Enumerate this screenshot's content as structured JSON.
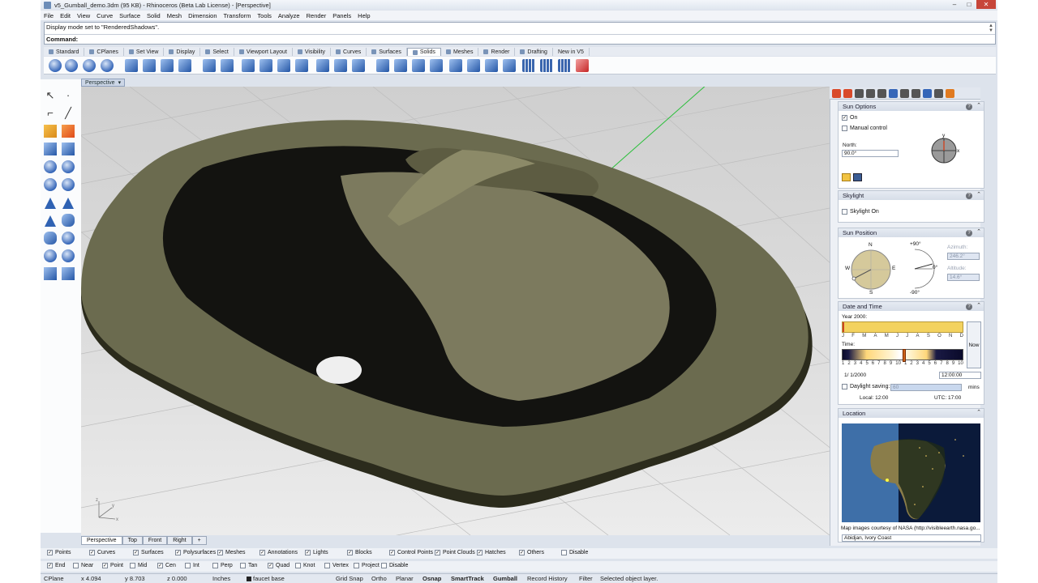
{
  "window": {
    "title": "v5_Gumball_demo.3dm (95 KB) - Rhinoceros (Beta Lab License) - [Perspective]",
    "minimize": "–",
    "maximize": "□",
    "close": "✕"
  },
  "menu": [
    "File",
    "Edit",
    "View",
    "Curve",
    "Surface",
    "Solid",
    "Mesh",
    "Dimension",
    "Transform",
    "Tools",
    "Analyze",
    "Render",
    "Panels",
    "Help"
  ],
  "command": {
    "history": "Display mode set to \"RenderedShadows\".",
    "prompt": "Command:"
  },
  "toolbar_tabs": [
    "Standard",
    "CPlanes",
    "Set View",
    "Display",
    "Select",
    "Viewport Layout",
    "Visibility",
    "Curves",
    "Surfaces",
    "Solids",
    "Meshes",
    "Render",
    "Drafting",
    "New in V5"
  ],
  "toolbar_active_tab": "Solids",
  "viewport": {
    "name": "Perspective",
    "menu_arrow": "▾",
    "axis_labels": [
      "z",
      "y",
      "x"
    ]
  },
  "viewport_tabs": [
    "Perspective",
    "Top",
    "Front",
    "Right",
    "+"
  ],
  "filters": [
    "Points",
    "Curves",
    "Surfaces",
    "Polysurfaces",
    "Meshes",
    "Annotations",
    "Lights",
    "Blocks",
    "Control Points",
    "Point Clouds",
    "Hatches",
    "Others",
    "Disable"
  ],
  "osnaps": [
    "End",
    "Near",
    "Point",
    "Mid",
    "Cen",
    "Int",
    "Perp",
    "Tan",
    "Quad",
    "Knot",
    "Vertex",
    "Project",
    "Disable"
  ],
  "osnaps_checked": [
    "End",
    "Point",
    "Cen",
    "Quad"
  ],
  "status": {
    "cplane": "CPlane",
    "x": "x 4.094",
    "y": "y 8.703",
    "z": "z 0.000",
    "units": "Inches",
    "layer": "faucet base",
    "grid_snap": "Grid Snap",
    "ortho": "Ortho",
    "planar": "Planar",
    "osnap": "Osnap",
    "smarttrack": "SmartTrack",
    "gumball": "Gumball",
    "record_history": "Record History",
    "filter": "Filter",
    "message": "Selected object layer."
  },
  "sun_panel": {
    "sun_options": {
      "title": "Sun Options",
      "on_label": "On",
      "manual_label": "Manual control",
      "north_label": "North:",
      "north_value": "90.0°",
      "compass_labels": [
        "y",
        "x"
      ]
    },
    "skylight": {
      "title": "Skylight",
      "on_label": "Skylight On"
    },
    "sun_position": {
      "title": "Sun Position",
      "compass": [
        "N",
        "E",
        "S",
        "W"
      ],
      "altitude_ticks": [
        "+90°",
        "0°",
        "-90°"
      ],
      "azimuth_label": "Azimuth:",
      "azimuth_value": "246.2°",
      "altitude_label": "Altitude:",
      "altitude_value": "14.6°"
    },
    "date_time": {
      "title": "Date and Time",
      "year_label": "Year 2000:",
      "months": [
        "J",
        "F",
        "M",
        "A",
        "M",
        "J",
        "J",
        "A",
        "S",
        "O",
        "N",
        "D"
      ],
      "time_label": "Time:",
      "hours": [
        "1",
        "2",
        "3",
        "4",
        "5",
        "6",
        "7",
        "8",
        "9",
        "10",
        "1",
        "2",
        "3",
        "4",
        "5",
        "6",
        "7",
        "8",
        "9",
        "10"
      ],
      "now_label": "Now",
      "date_value": "1/  1/2000",
      "time_value": "12:00:00",
      "daylight_label": "Daylight saving:",
      "daylight_value": "60",
      "mins_label": "mins",
      "local_label": "Local: 12:00",
      "utc_label": "UTC: 17:00"
    },
    "location": {
      "title": "Location",
      "credit": "Map images courtesy of NASA (http://visibleearth.nasa.go...",
      "city": "Abidjan, Ivory Coast"
    },
    "help_glyph": "?",
    "collapse_glyph": "⌃"
  },
  "colors": {
    "accent": "#3566b8",
    "sink": "#6b6b4f",
    "viewport_bg": "#d9d9d9",
    "year_bar": "#f3d25f"
  }
}
